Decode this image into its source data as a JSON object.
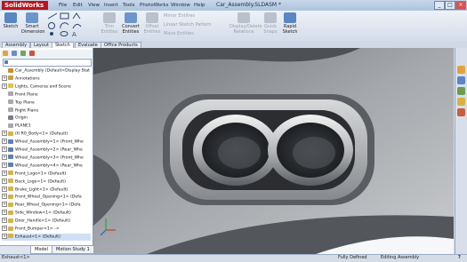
{
  "app": {
    "logo": "SolidWorks",
    "document_title": "Car_Assembly.SLDASM *"
  },
  "menus": [
    "File",
    "Edit",
    "View",
    "Insert",
    "Tools",
    "PhotoWorks",
    "Window",
    "Help"
  ],
  "window_buttons": [
    "_",
    "□",
    "×"
  ],
  "command_manager": {
    "sketch": "Sketch",
    "smart_dimension": "Smart\nDimension",
    "trim_entities": "Trim\nEntities",
    "convert_entities": "Convert\nEntities",
    "offset_entities": "Offset\nEntities",
    "mirror_entities": "Mirror Entities",
    "linear_sketch_pattern": "Linear Sketch Pattern",
    "move_entities": "Move Entities",
    "display_delete_relations": "Display/Delete\nRelations",
    "quick_snaps": "Quick\nSnaps",
    "rapid_sketch": "Rapid\nSketch"
  },
  "command_tabs": [
    "Assembly",
    "Layout",
    "Sketch",
    "Evaluate",
    "Office Products"
  ],
  "active_command_tab": "Sketch",
  "feature_tree": [
    {
      "label": "Car_Assembly  (Default<Display Stat",
      "icon": "#d08a2a",
      "expander": ""
    },
    {
      "label": "Annotations",
      "icon": "#c59c4a",
      "expander": "+"
    },
    {
      "label": "Lights, Cameras and Scene",
      "icon": "#e4c04a",
      "expander": "+"
    },
    {
      "label": "Front Plane",
      "icon": "#a7a9ad",
      "expander": ""
    },
    {
      "label": "Top Plane",
      "icon": "#a7a9ad",
      "expander": ""
    },
    {
      "label": "Right Plane",
      "icon": "#a7a9ad",
      "expander": ""
    },
    {
      "label": "Origin",
      "icon": "#7a7f88",
      "expander": ""
    },
    {
      "label": "PLANE1",
      "icon": "#a7a9ad",
      "expander": ""
    },
    {
      "label": "(f) R0_Body<1> (Default)",
      "icon": "#d6b24a",
      "expander": "+"
    },
    {
      "label": "Wheel_Assembly<1> (Front_Whe",
      "icon": "#5e7fb3",
      "expander": "+"
    },
    {
      "label": "Wheel_Assembly<2> (Rear_Whe",
      "icon": "#5e7fb3",
      "expander": "+"
    },
    {
      "label": "Wheel_Assembly<3> (Front_Whe",
      "icon": "#5e7fb3",
      "expander": "+"
    },
    {
      "label": "Wheel_Assembly<4> (Rear_Whe",
      "icon": "#5e7fb3",
      "expander": "+"
    },
    {
      "label": "Front_Logo<1> (Default)",
      "icon": "#d6b24a",
      "expander": "+"
    },
    {
      "label": "Back_Logo<1> (Default)",
      "icon": "#d6b24a",
      "expander": "+"
    },
    {
      "label": "Brake_Light<1> (Default)",
      "icon": "#d6b24a",
      "expander": "+"
    },
    {
      "label": "Front_Wheel_Opening<1> (Defa",
      "icon": "#d6b24a",
      "expander": "+"
    },
    {
      "label": "Rear_Wheel_Opening<1> (Defa",
      "icon": "#d6b24a",
      "expander": "+"
    },
    {
      "label": "Side_Window<1> (Default)",
      "icon": "#d6b24a",
      "expander": "+"
    },
    {
      "label": "Door_Handle<1> (Default)",
      "icon": "#d6b24a",
      "expander": "+"
    },
    {
      "label": "Front_Bumper<1> ->",
      "icon": "#d6b24a",
      "expander": "+"
    },
    {
      "label": "Exhaust<1> (Default)",
      "icon": "#d6b24a",
      "expander": "+"
    }
  ],
  "bottom_tabs": [
    "Model",
    "Motion Study 1"
  ],
  "status": {
    "left": "Exhaust<1>",
    "defined": "Fully Defined",
    "mode": "Editing Assembly",
    "help": "?"
  },
  "colors": {
    "accent": "#b9141b",
    "selection": "#cfe0f5"
  }
}
